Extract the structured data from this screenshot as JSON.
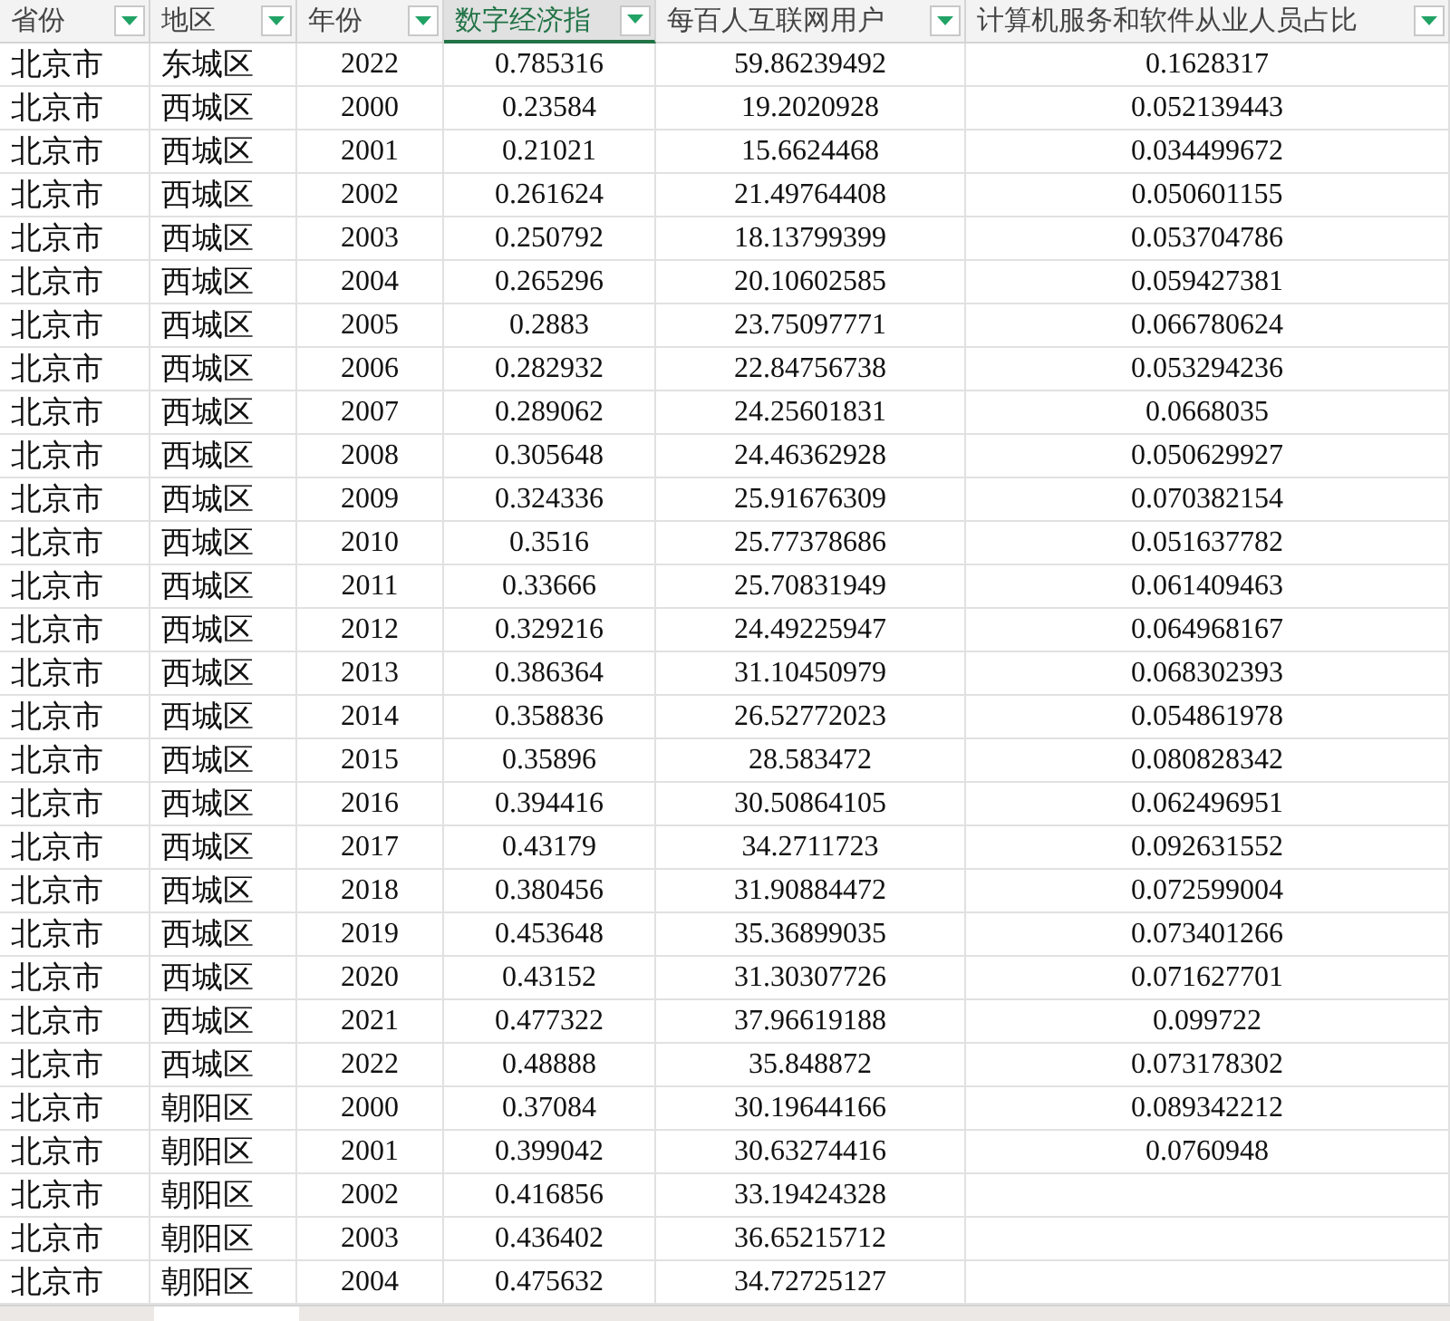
{
  "table": {
    "columns": [
      {
        "label": "省份",
        "selected": false
      },
      {
        "label": "地区",
        "selected": false
      },
      {
        "label": "年份",
        "selected": false
      },
      {
        "label": "数字经济指",
        "selected": true
      },
      {
        "label": "每百人互联网用户",
        "selected": false
      },
      {
        "label": "计算机服务和软件从业人员占比",
        "selected": false
      }
    ],
    "rows": [
      [
        "北京市",
        "东城区",
        "2022",
        "0.785316",
        "59.86239492",
        "0.1628317"
      ],
      [
        "北京市",
        "西城区",
        "2000",
        "0.23584",
        "19.2020928",
        "0.052139443"
      ],
      [
        "北京市",
        "西城区",
        "2001",
        "0.21021",
        "15.6624468",
        "0.034499672"
      ],
      [
        "北京市",
        "西城区",
        "2002",
        "0.261624",
        "21.49764408",
        "0.050601155"
      ],
      [
        "北京市",
        "西城区",
        "2003",
        "0.250792",
        "18.13799399",
        "0.053704786"
      ],
      [
        "北京市",
        "西城区",
        "2004",
        "0.265296",
        "20.10602585",
        "0.059427381"
      ],
      [
        "北京市",
        "西城区",
        "2005",
        "0.2883",
        "23.75097771",
        "0.066780624"
      ],
      [
        "北京市",
        "西城区",
        "2006",
        "0.282932",
        "22.84756738",
        "0.053294236"
      ],
      [
        "北京市",
        "西城区",
        "2007",
        "0.289062",
        "24.25601831",
        "0.0668035"
      ],
      [
        "北京市",
        "西城区",
        "2008",
        "0.305648",
        "24.46362928",
        "0.050629927"
      ],
      [
        "北京市",
        "西城区",
        "2009",
        "0.324336",
        "25.91676309",
        "0.070382154"
      ],
      [
        "北京市",
        "西城区",
        "2010",
        "0.3516",
        "25.77378686",
        "0.051637782"
      ],
      [
        "北京市",
        "西城区",
        "2011",
        "0.33666",
        "25.70831949",
        "0.061409463"
      ],
      [
        "北京市",
        "西城区",
        "2012",
        "0.329216",
        "24.49225947",
        "0.064968167"
      ],
      [
        "北京市",
        "西城区",
        "2013",
        "0.386364",
        "31.10450979",
        "0.068302393"
      ],
      [
        "北京市",
        "西城区",
        "2014",
        "0.358836",
        "26.52772023",
        "0.054861978"
      ],
      [
        "北京市",
        "西城区",
        "2015",
        "0.35896",
        "28.583472",
        "0.080828342"
      ],
      [
        "北京市",
        "西城区",
        "2016",
        "0.394416",
        "30.50864105",
        "0.062496951"
      ],
      [
        "北京市",
        "西城区",
        "2017",
        "0.43179",
        "34.2711723",
        "0.092631552"
      ],
      [
        "北京市",
        "西城区",
        "2018",
        "0.380456",
        "31.90884472",
        "0.072599004"
      ],
      [
        "北京市",
        "西城区",
        "2019",
        "0.453648",
        "35.36899035",
        "0.073401266"
      ],
      [
        "北京市",
        "西城区",
        "2020",
        "0.43152",
        "31.30307726",
        "0.071627701"
      ],
      [
        "北京市",
        "西城区",
        "2021",
        "0.477322",
        "37.96619188",
        "0.099722"
      ],
      [
        "北京市",
        "西城区",
        "2022",
        "0.48888",
        "35.848872",
        "0.073178302"
      ],
      [
        "北京市",
        "朝阳区",
        "2000",
        "0.37084",
        "30.19644166",
        "0.089342212"
      ],
      [
        "北京市",
        "朝阳区",
        "2001",
        "0.399042",
        "30.63274416",
        "0.0760948"
      ],
      [
        "北京市",
        "朝阳区",
        "2002",
        "0.416856",
        "33.19424328",
        null
      ],
      [
        "北京市",
        "朝阳区",
        "2003",
        "0.436402",
        "36.65215712",
        null
      ],
      [
        "北京市",
        "朝阳区",
        "2004",
        "0.475632",
        "34.72725127",
        null
      ]
    ]
  }
}
